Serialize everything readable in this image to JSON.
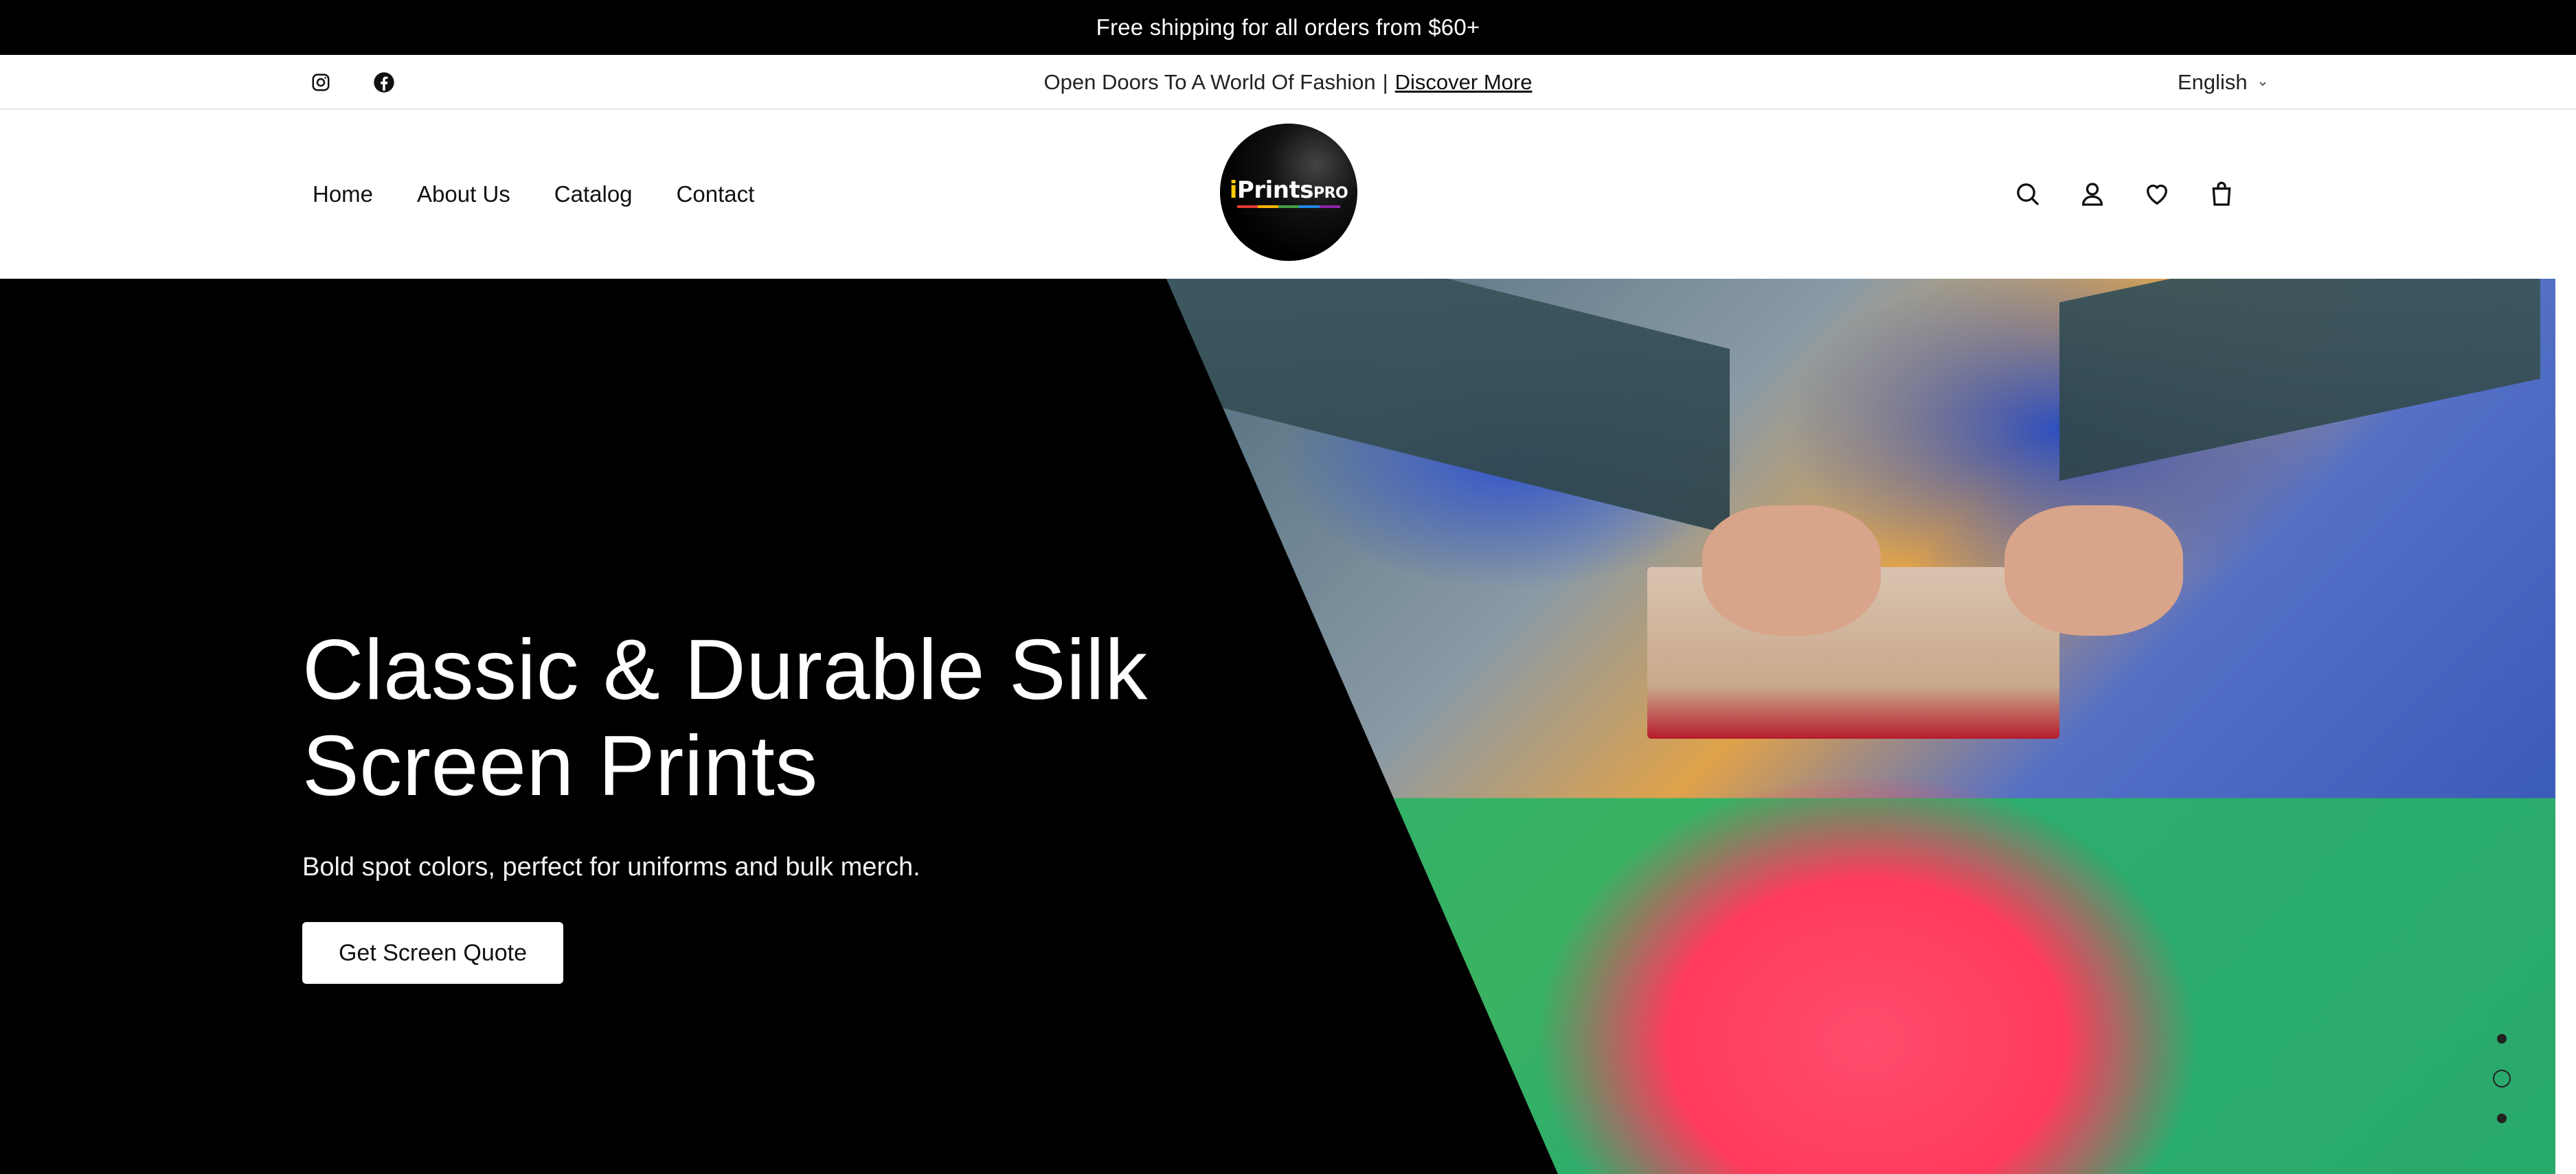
{
  "announcement": {
    "text": "Free shipping for all orders from $60+"
  },
  "utility": {
    "social_icons": [
      "instagram-icon",
      "facebook-icon"
    ],
    "promo_text": "Open Doors To A World Of Fashion",
    "promo_separator": "|",
    "promo_link": "Discover More",
    "language": "English"
  },
  "header": {
    "nav": [
      "Home",
      "About Us",
      "Catalog",
      "Contact"
    ],
    "logo": {
      "brand_i": "i",
      "brand_main": "Prints",
      "brand_suffix": "PRO"
    },
    "icons": [
      "search-icon",
      "account-icon",
      "wishlist-icon",
      "cart-icon"
    ]
  },
  "hero": {
    "title_line1": "Classic & Durable Silk",
    "title_line2": "Screen Prints",
    "subtitle": "Bold spot colors, perfect for uniforms and bulk merch.",
    "cta_label": "Get Screen Quote",
    "slides": {
      "count": 3,
      "active": 2
    }
  },
  "colors": {
    "announcement_bg": "#000000",
    "hero_bg": "#000000",
    "text_light": "#ffffff",
    "button_bg": "#ffffff"
  }
}
